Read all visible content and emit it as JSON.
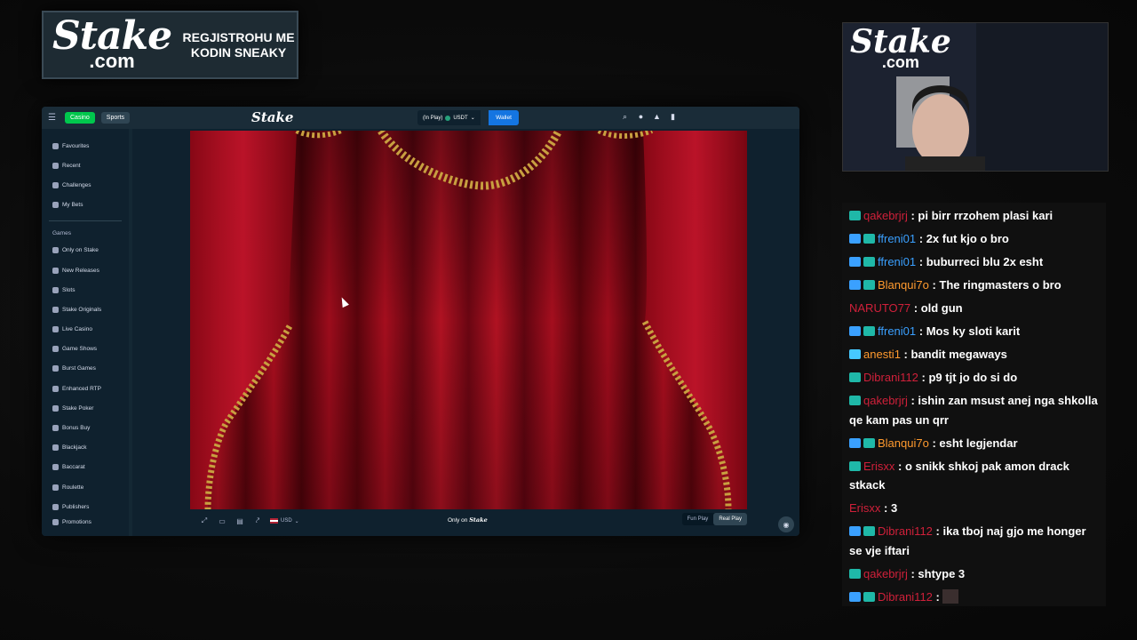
{
  "promo": {
    "logo_big": "Stake",
    "logo_small": ".com",
    "text": "REGJISTROHU ME KODIN SNEAKY"
  },
  "browser": {
    "topbar": {
      "casino_label": "Casino",
      "sports_label": "Sports",
      "brand": "Stake",
      "balance_label": "(In Play)",
      "currency_label": "USDT",
      "wallet_label": "Wallet"
    },
    "sidebar": {
      "items_top": [
        {
          "label": "Favourites",
          "icon": "star-icon"
        },
        {
          "label": "Recent",
          "icon": "clock-icon"
        },
        {
          "label": "Challenges",
          "icon": "trophy-icon"
        },
        {
          "label": "My Bets",
          "icon": "list-icon"
        }
      ],
      "games_heading": "Games",
      "items_games": [
        {
          "label": "Only on Stake",
          "icon": "stake-icon"
        },
        {
          "label": "New Releases",
          "icon": "new-icon"
        },
        {
          "label": "Slots",
          "icon": "slots-icon"
        },
        {
          "label": "Stake Originals",
          "icon": "originals-icon"
        },
        {
          "label": "Live Casino",
          "icon": "live-icon"
        },
        {
          "label": "Game Shows",
          "icon": "show-icon"
        },
        {
          "label": "Burst Games",
          "icon": "burst-icon"
        },
        {
          "label": "Enhanced RTP",
          "icon": "rtp-icon"
        },
        {
          "label": "Stake Poker",
          "icon": "poker-icon"
        },
        {
          "label": "Bonus Buy",
          "icon": "bonus-icon"
        },
        {
          "label": "Blackjack",
          "icon": "blackjack-icon"
        },
        {
          "label": "Baccarat",
          "icon": "baccarat-icon"
        },
        {
          "label": "Roulette",
          "icon": "roulette-icon"
        },
        {
          "label": "Publishers",
          "icon": "publishers-icon"
        },
        {
          "label": "Promotions",
          "icon": "promo-icon"
        }
      ]
    },
    "footer": {
      "currency": "USD",
      "only_on_prefix": "Only on",
      "only_on_brand": "Stake",
      "fun_play": "Fun Play",
      "real_play": "Real Play"
    }
  },
  "cam": {
    "logo_big": "Stake",
    "logo_small": ".com"
  },
  "chat": {
    "messages": [
      {
        "user": "qakebrjrj",
        "color": "#d0203a",
        "badges": [
          "b1"
        ],
        "text": "pi birr rrzohem plasi kari"
      },
      {
        "user": "ffreni01",
        "color": "#3aa0ff",
        "badges": [
          "b2",
          "b1"
        ],
        "text": "2x fut kjo o bro"
      },
      {
        "user": "ffreni01",
        "color": "#3aa0ff",
        "badges": [
          "b2",
          "b1"
        ],
        "text": "buburreci blu 2x esht"
      },
      {
        "user": "Blanqui7o",
        "color": "#ff9a2e",
        "badges": [
          "b2",
          "b1"
        ],
        "text": "The ringmasters o bro"
      },
      {
        "user": "NARUTO77",
        "color": "#d0203a",
        "badges": [],
        "text": "old gun"
      },
      {
        "user": "ffreni01",
        "color": "#3aa0ff",
        "badges": [
          "b2",
          "b1"
        ],
        "text": "Mos ky sloti karit"
      },
      {
        "user": "anesti1",
        "color": "#ff9a2e",
        "badges": [
          "b3"
        ],
        "text": "bandit megaways"
      },
      {
        "user": "Dibrani112",
        "color": "#d0203a",
        "badges": [
          "b1"
        ],
        "text": "p9 tjt jo do si do"
      },
      {
        "user": "qakebrjrj",
        "color": "#d0203a",
        "badges": [
          "b1"
        ],
        "text": "ishin zan msust anej nga shkolla qe kam pas un qrr"
      },
      {
        "user": "Blanqui7o",
        "color": "#ff9a2e",
        "badges": [
          "b2",
          "b1"
        ],
        "text": "esht legjendar"
      },
      {
        "user": "Erisxx",
        "color": "#d0203a",
        "badges": [
          "b1"
        ],
        "text": "o snikk shkoj pak amon drack stkack"
      },
      {
        "user": "Erisxx",
        "color": "#d0203a",
        "badges": [],
        "text": "3"
      },
      {
        "user": "Dibrani112",
        "color": "#d0203a",
        "badges": [
          "b2",
          "b1"
        ],
        "text": "ika tboj naj gjo me honger se vje iftari"
      },
      {
        "user": "qakebrjrj",
        "color": "#d0203a",
        "badges": [
          "b1"
        ],
        "text": "shtype 3"
      },
      {
        "user": "Dibrani112",
        "color": "#d0203a",
        "badges": [
          "b2",
          "b1"
        ],
        "text": ""
      }
    ]
  }
}
